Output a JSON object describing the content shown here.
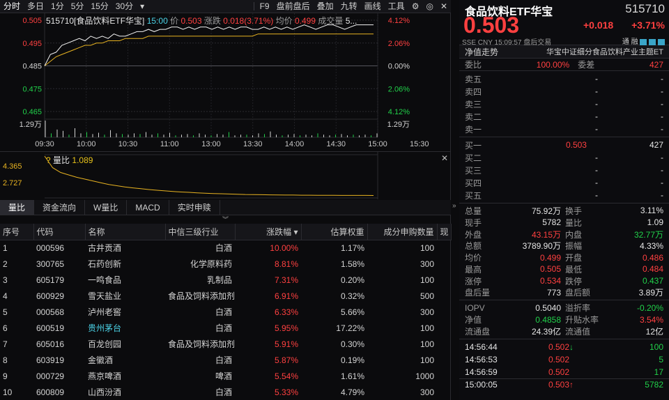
{
  "toolbar": {
    "items": [
      "分时",
      "多日",
      "1分",
      "5分",
      "15分",
      "30分"
    ],
    "more": "▾",
    "right": [
      "F9",
      "盘前盘后",
      "叠加",
      "九转",
      "画线",
      "工具"
    ]
  },
  "chart_header": {
    "name": "515710[食品饮料ETF华宝]",
    "time": "15:00",
    "price_label": "价",
    "price": "0.503",
    "change_label": "涨跌",
    "change": "0.018(3.71%)",
    "avg_label": "均价",
    "avg": "0.499",
    "vol_label": "成交量",
    "vol": "5..."
  },
  "chart_data": {
    "type": "line",
    "title": "515710[食品饮料ETF华宝]",
    "y_ticks_left": [
      "0.505",
      "0.495",
      "0.485",
      "0.475",
      "0.465"
    ],
    "y_ticks_right": [
      "4.12%",
      "2.06%",
      "0.00%",
      "2.06%",
      "4.12%"
    ],
    "x_ticks": [
      "09:30",
      "10:00",
      "10:30",
      "11:00",
      "13:00",
      "13:30",
      "14:00",
      "14:30",
      "15:00",
      "15:30"
    ],
    "ylim": [
      0.465,
      0.505
    ],
    "prev_close": 0.485,
    "vol_tick": "1.29万",
    "series": [
      {
        "values": [
          0.485,
          0.49,
          0.491,
          0.494,
          0.495,
          0.496,
          0.497,
          0.496,
          0.498,
          0.497,
          0.498,
          0.497,
          0.499,
          0.498,
          0.498,
          0.499,
          0.5,
          0.5,
          0.501,
          0.5,
          0.501,
          0.501,
          0.502,
          0.502,
          0.501,
          0.502,
          0.501,
          0.502,
          0.502,
          0.501,
          0.502,
          0.501,
          0.502,
          0.501,
          0.502,
          0.502,
          0.501,
          0.501,
          0.502,
          0.501,
          0.502,
          0.501,
          0.502,
          0.501,
          0.502,
          0.503,
          0.502,
          0.501,
          0.502,
          0.503,
          0.503,
          0.502,
          0.501,
          0.502,
          0.503,
          0.503,
          0.503,
          0.503
        ]
      },
      {
        "values": [
          0.485,
          0.487,
          0.489,
          0.49,
          0.491,
          0.492,
          0.493,
          0.494,
          0.494,
          0.495,
          0.495,
          0.496,
          0.496,
          0.496,
          0.497,
          0.497,
          0.497,
          0.497,
          0.498,
          0.498,
          0.498,
          0.498,
          0.498,
          0.498,
          0.498,
          0.498,
          0.498,
          0.498,
          0.498,
          0.498,
          0.498,
          0.498,
          0.498,
          0.498,
          0.498,
          0.498,
          0.498,
          0.499,
          0.499,
          0.499,
          0.499,
          0.499,
          0.499,
          0.499,
          0.499,
          0.499,
          0.499,
          0.499,
          0.499,
          0.499,
          0.499,
          0.499,
          0.499,
          0.499,
          0.499,
          0.499,
          0.499,
          0.499
        ]
      }
    ],
    "volume": [
      1.29,
      0.3,
      0.6,
      0.5,
      0.2,
      0.7,
      0.3,
      0.4,
      0.25,
      0.35,
      0.2,
      0.55,
      0.3,
      0.25,
      0.2,
      0.3,
      0.25,
      0.4,
      0.2,
      0.3,
      0.2,
      0.35,
      0.15,
      0.2,
      0.25,
      0.15,
      0.3,
      0.2,
      0.15,
      0.25,
      0.2,
      0.4,
      0.15,
      0.2,
      0.2,
      0.15,
      0.3,
      0.25,
      0.45,
      0.2,
      0.15,
      0.2,
      0.25,
      0.15,
      0.2,
      0.15,
      0.3,
      0.2,
      0.15,
      0.2,
      0.25,
      0.15,
      0.2,
      0.15,
      0.2,
      0.15,
      0.3
    ]
  },
  "vol_panel": {
    "label": "量比",
    "value": "1.089",
    "ticks": [
      "4.365",
      "2.727"
    ],
    "values": [
      4.365,
      3.4,
      3.0,
      2.8,
      2.6,
      2.45,
      2.3,
      2.15,
      2.0,
      1.9,
      1.8,
      1.72,
      1.65,
      1.58,
      1.52,
      1.47,
      1.42,
      1.38,
      1.35,
      1.31,
      1.28,
      1.25,
      1.23,
      1.21,
      1.19,
      1.17,
      1.16,
      1.15,
      1.14,
      1.13,
      1.12,
      1.12,
      1.11,
      1.11,
      1.1,
      1.1,
      1.1,
      1.09,
      1.09,
      1.09,
      1.09,
      1.089
    ],
    "ylim": [
      1.0,
      4.365
    ]
  },
  "tabs": [
    "量比",
    "资金流向",
    "W量比",
    "MACD",
    "实时申赎"
  ],
  "table": {
    "headers": [
      "序号",
      "代码",
      "名称",
      "中信三级行业",
      "涨跌幅 ▾",
      "估算权重",
      "成分申购数量",
      "现"
    ],
    "rows": [
      [
        "1",
        "000596",
        "古井贡酒",
        "白酒",
        "10.00%",
        "1.17%",
        "100"
      ],
      [
        "2",
        "300765",
        "石药创新",
        "化学原料药",
        "8.81%",
        "1.58%",
        "300"
      ],
      [
        "3",
        "605179",
        "一鸣食品",
        "乳制品",
        "7.31%",
        "0.20%",
        "100"
      ],
      [
        "4",
        "600929",
        "雪天盐业",
        "食品及饲料添加剂",
        "6.91%",
        "0.32%",
        "500"
      ],
      [
        "5",
        "000568",
        "泸州老窖",
        "白酒",
        "6.33%",
        "5.66%",
        "300"
      ],
      [
        "6",
        "600519",
        "贵州茅台",
        "白酒",
        "5.95%",
        "17.22%",
        "100"
      ],
      [
        "7",
        "605016",
        "百龙创园",
        "食品及饲料添加剂",
        "5.91%",
        "0.30%",
        "100"
      ],
      [
        "8",
        "603919",
        "金徽酒",
        "白酒",
        "5.87%",
        "0.19%",
        "100"
      ],
      [
        "9",
        "000729",
        "燕京啤酒",
        "啤酒",
        "5.54%",
        "1.61%",
        "1000"
      ],
      [
        "10",
        "600809",
        "山西汾酒",
        "白酒",
        "5.33%",
        "4.79%",
        "300"
      ]
    ]
  },
  "quote": {
    "name": "食品饮料ETF华宝",
    "code": "515710",
    "price": "0.503",
    "change": "+0.018",
    "pct": "+3.71%",
    "market": "SSE",
    "currency": "CNY",
    "time": "15:09:57",
    "after": "盘后交易",
    "flags": [
      "通",
      "融"
    ],
    "nav_trend": "净值走势",
    "index_name": "华宝中证细分食品饮料产业主题ET",
    "weibi_label": "委比",
    "weibi": "100.00%",
    "weicha_label": "委差",
    "weicha": "427",
    "sell": [
      [
        "卖五",
        "-",
        "-"
      ],
      [
        "卖四",
        "-",
        "-"
      ],
      [
        "卖三",
        "-",
        "-"
      ],
      [
        "卖二",
        "-",
        "-"
      ],
      [
        "卖一",
        "-",
        "-"
      ]
    ],
    "buy": [
      [
        "买一",
        "0.503",
        "427"
      ],
      [
        "买二",
        "-",
        "-"
      ],
      [
        "买三",
        "-",
        "-"
      ],
      [
        "买四",
        "-",
        "-"
      ],
      [
        "买五",
        "-",
        "-"
      ]
    ],
    "stats": [
      [
        "总量",
        "75.92万",
        "换手",
        "3.11%"
      ],
      [
        "现手",
        "5782",
        "量比",
        "1.09"
      ],
      [
        "外盘",
        "43.15万",
        "内盘",
        "32.77万"
      ],
      [
        "总额",
        "3789.90万",
        "振幅",
        "4.33%"
      ],
      [
        "均价",
        "0.499",
        "开盘",
        "0.486"
      ],
      [
        "最高",
        "0.505",
        "最低",
        "0.484"
      ],
      [
        "涨停",
        "0.534",
        "跌停",
        "0.437"
      ],
      [
        "盘后量",
        "773",
        "盘后额",
        "3.89万"
      ]
    ],
    "iopv": [
      [
        "IOPV",
        "0.5040",
        "溢折率",
        "-0.20%"
      ],
      [
        "净值",
        "0.4858",
        "升贴水率",
        "3.54%"
      ],
      [
        "流通盘",
        "24.39亿",
        "流通值",
        "12亿"
      ]
    ],
    "ticks": [
      [
        "14:56:44",
        "0.502",
        "↓",
        "100"
      ],
      [
        "14:56:53",
        "0.502",
        "",
        "5"
      ],
      [
        "14:56:59",
        "0.502",
        "",
        "17"
      ],
      [
        "15:00:05",
        "0.503",
        "↑",
        "5782"
      ]
    ]
  }
}
